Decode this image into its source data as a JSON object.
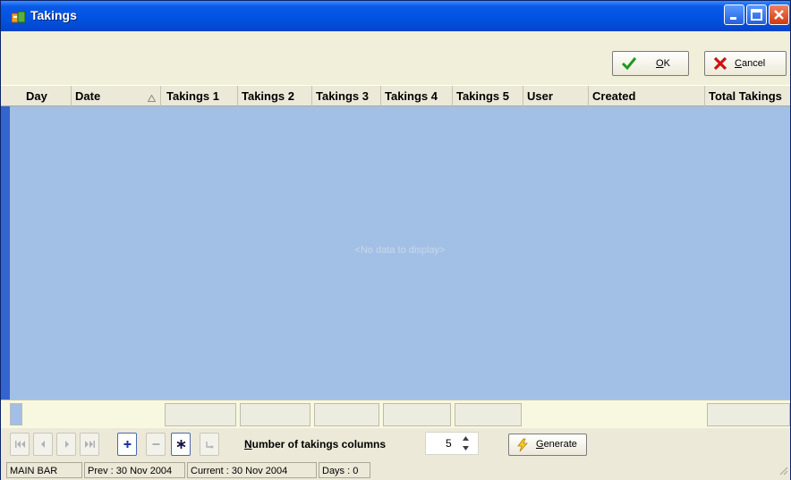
{
  "window": {
    "title": "Takings",
    "icon": "app-icon"
  },
  "toolbar": {
    "ok_label": "OK",
    "cancel_label": "Cancel"
  },
  "grid": {
    "columns": [
      "Day",
      "Date",
      "Takings 1",
      "Takings 2",
      "Takings 3",
      "Takings 4",
      "Takings 5",
      "User",
      "Created",
      "Total Takings"
    ],
    "sorted_column": "Date",
    "empty_text": "<No data to display>",
    "rows": []
  },
  "navigator": {
    "buttons": [
      "first-record",
      "prior-page",
      "prior-record",
      "next-record",
      "next-page",
      "last-record",
      "insert",
      "delete",
      "edit",
      "post"
    ],
    "columns_label": "Number of takings columns",
    "columns_value": "5",
    "generate_label": "Generate"
  },
  "status": {
    "location": "MAIN BAR",
    "prev": "Prev : 30 Nov 2004",
    "current": "Current : 30 Nov 2004",
    "days": "Days : 0"
  },
  "colors": {
    "titlebar": "#0052E0",
    "grid_background": "#A2C0E5",
    "window_background": "#ECE9D8"
  }
}
